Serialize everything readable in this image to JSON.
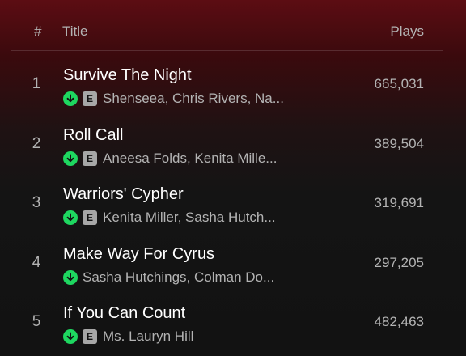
{
  "header": {
    "num_label": "#",
    "title_label": "Title",
    "plays_label": "Plays"
  },
  "tracks": [
    {
      "num": "1",
      "title": "Survive The Night",
      "explicit": "E",
      "artists": "Shenseea, Chris Rivers, Na...",
      "plays": "665,031"
    },
    {
      "num": "2",
      "title": "Roll Call",
      "explicit": "E",
      "artists": "Aneesa Folds, Kenita Mille...",
      "plays": "389,504"
    },
    {
      "num": "3",
      "title": "Warriors' Cypher",
      "explicit": "E",
      "artists": "Kenita Miller, Sasha Hutch...",
      "plays": "319,691"
    },
    {
      "num": "4",
      "title": "Make Way For Cyrus",
      "explicit": "",
      "artists": "Sasha Hutchings, Colman Do...",
      "plays": "297,205"
    },
    {
      "num": "5",
      "title": "If You Can Count",
      "explicit": "E",
      "artists": "Ms. Lauryn Hill",
      "plays": "482,463"
    }
  ],
  "icons": {
    "downloaded": "download-complete-icon",
    "explicit": "explicit-badge"
  },
  "colors": {
    "accent_green": "#1ed760",
    "header_red": "#5c0d13",
    "background": "#121212",
    "secondary_text": "#b3b3b3"
  }
}
